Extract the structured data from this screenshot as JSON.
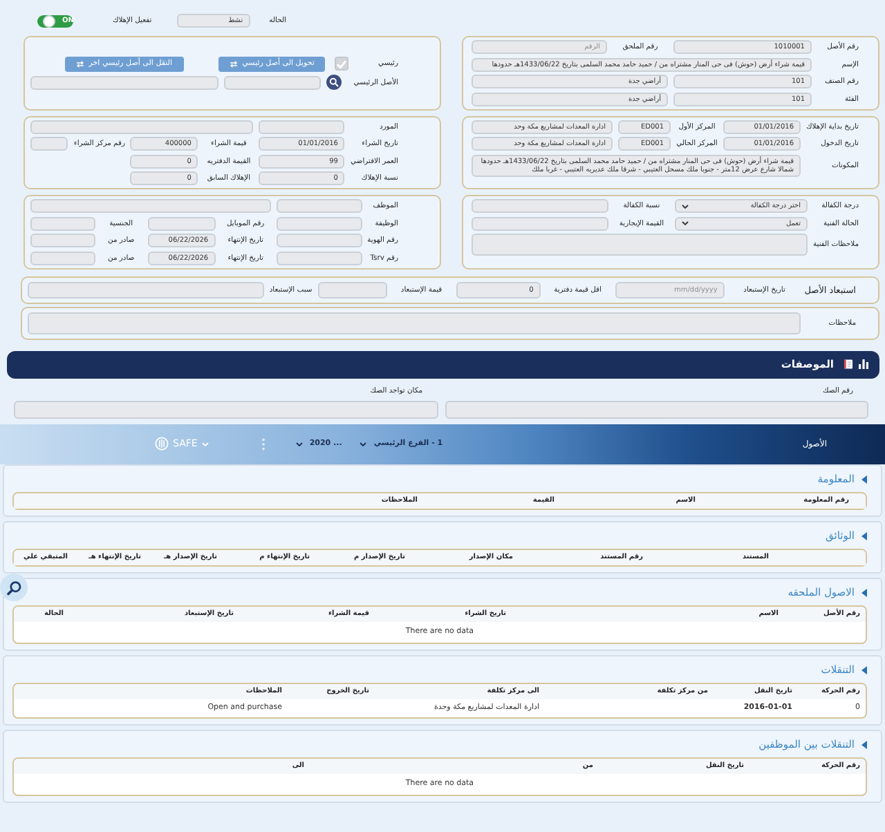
{
  "header": {
    "status": {
      "label": "الحاله",
      "value": "نشط"
    },
    "depreciation": {
      "label": "تفعيل الإهلاك",
      "text": "ON",
      "on": true
    }
  },
  "boxes": [
    {
      "rows": [
        [
          {
            "kind": "label",
            "text": "رقم الأصل"
          },
          {
            "kind": "field",
            "value": "1010001"
          },
          {
            "kind": "label",
            "text": "رقم الملحق"
          },
          {
            "kind": "field",
            "placeholder": "الرقم"
          }
        ],
        [
          {
            "kind": "label",
            "text": "الإسم"
          },
          {
            "kind": "wide",
            "value": "قيمة شراء أرض (حوش) فى حى المنار مشتراه من / حميد حامد محمد السلمى بتاريخ 1433/06/22هـ حدودها"
          }
        ],
        [
          {
            "kind": "label",
            "text": "رقم الصنف"
          },
          {
            "kind": "field",
            "value": "101"
          },
          {
            "kind": "wide",
            "value": "أراضي جدة"
          }
        ],
        [
          {
            "kind": "label",
            "text": "الفئة"
          },
          {
            "kind": "field",
            "value": "101"
          },
          {
            "kind": "wide",
            "value": "أراضي جدة"
          }
        ]
      ]
    },
    {
      "rows": [
        [
          {
            "kind": "label",
            "text": "رئيسي"
          },
          {
            "kind": "check",
            "checked": true,
            "disabled": true
          },
          {
            "kind": "button",
            "text": "تحويل الى أصل رئيسي"
          },
          {
            "kind": "button",
            "text": "النقل الى أصل رئيسي اخر"
          }
        ],
        [
          {
            "kind": "label",
            "text": "الأصل الرئيسي"
          },
          {
            "kind": "search"
          },
          {
            "kind": "field"
          },
          {
            "kind": "wide"
          }
        ]
      ]
    },
    {
      "rows": [
        [
          {
            "kind": "label",
            "text": "تاريخ بداية الإهلاك"
          },
          {
            "kind": "field",
            "value": "01/01/2016"
          },
          {
            "kind": "label",
            "text": "المركز الأول"
          },
          {
            "kind": "field",
            "value": "ED001"
          },
          {
            "kind": "field",
            "value": "ادارة المعدات لمشاريع مكة وحد"
          }
        ],
        [
          {
            "kind": "label",
            "text": "تاريخ الدخول"
          },
          {
            "kind": "field",
            "value": "01/01/2016"
          },
          {
            "kind": "label",
            "text": "المركز الحالي"
          },
          {
            "kind": "field",
            "value": "ED001"
          },
          {
            "kind": "field",
            "value": "ادارة المعدات لمشاريع مكة وحد"
          }
        ],
        [
          {
            "kind": "label",
            "text": "المكونات"
          },
          {
            "kind": "area",
            "value": "قيمة شراء أرض (حوش) فى حى المنار مشتراه من / حميد حامد محمد السلمى بتاريخ 1433/06/22هـ حدودها شمالا شارع عرض 12متر - جنوبا ملك مسحل العتيبي - شرقا ملك عديريه العتيبي - غربا ملك"
          }
        ]
      ]
    },
    {
      "rows": [
        [
          {
            "kind": "label",
            "text": "المورد"
          },
          {
            "kind": "field"
          },
          {
            "kind": "wide"
          }
        ],
        [
          {
            "kind": "label",
            "text": "تاريخ الشراء"
          },
          {
            "kind": "field",
            "value": "01/01/2016"
          },
          {
            "kind": "label",
            "text": "قيمة الشراء"
          },
          {
            "kind": "field",
            "value": "400000"
          },
          {
            "kind": "label",
            "text": "رقم مركز الشراء"
          },
          {
            "kind": "field"
          }
        ],
        [
          {
            "kind": "label",
            "text": "العمر الافتراضي"
          },
          {
            "kind": "field",
            "value": "99"
          },
          {
            "kind": "label",
            "text": "القيمة الدفتريه"
          },
          {
            "kind": "field",
            "value": "0"
          }
        ],
        [
          {
            "kind": "label",
            "text": "نسبة الإهلاك"
          },
          {
            "kind": "field",
            "value": "0"
          },
          {
            "kind": "label",
            "text": "الإهلاك السابق"
          },
          {
            "kind": "field",
            "value": "0"
          }
        ]
      ]
    },
    {
      "rows": [
        [
          {
            "kind": "label",
            "text": "درجة الكفالة"
          },
          {
            "kind": "select",
            "value": "اختر درجة الكفالة"
          },
          {
            "kind": "label",
            "text": "نسبة الكفالة"
          },
          {
            "kind": "field"
          }
        ],
        [
          {
            "kind": "label",
            "text": "الحالة الفنية"
          },
          {
            "kind": "select",
            "value": "تعمل"
          },
          {
            "kind": "label",
            "text": "القيمة الإيجارية"
          },
          {
            "kind": "field"
          }
        ],
        [
          {
            "kind": "label",
            "text": "ملاحظات الفنية"
          },
          {
            "kind": "area"
          }
        ]
      ]
    },
    {
      "rows": [
        [
          {
            "kind": "label",
            "text": "الموظف"
          },
          {
            "kind": "field"
          },
          {
            "kind": "wide"
          }
        ],
        [
          {
            "kind": "label",
            "text": "الوظيفة"
          },
          {
            "kind": "field"
          },
          {
            "kind": "label",
            "text": "رقم الموبايل"
          },
          {
            "kind": "field"
          },
          {
            "kind": "label",
            "text": "الجنسية"
          },
          {
            "kind": "field"
          }
        ],
        [
          {
            "kind": "label",
            "text": "رقم الهوية"
          },
          {
            "kind": "field"
          },
          {
            "kind": "label",
            "text": "تاريخ الإنتهاء"
          },
          {
            "kind": "field",
            "value": "06/22/2026"
          },
          {
            "kind": "label",
            "text": "صادر من"
          },
          {
            "kind": "field"
          }
        ],
        [
          {
            "kind": "label",
            "text": "رقم Tsrv"
          },
          {
            "kind": "field"
          },
          {
            "kind": "label",
            "text": "تاريخ الإنتهاء"
          },
          {
            "kind": "field",
            "value": "06/22/2026"
          },
          {
            "kind": "label",
            "text": "صادر من"
          },
          {
            "kind": "field"
          }
        ]
      ]
    }
  ],
  "disposal": {
    "rows": [
      [
        {
          "kind": "heading",
          "text": "استبعاد الأصل"
        },
        {
          "kind": "label",
          "text": "تاريخ الإستبعاد"
        },
        {
          "kind": "field",
          "placeholder": "mm/dd/yyyy"
        },
        {
          "kind": "label",
          "text": "اقل قيمة دفترية"
        },
        {
          "kind": "field",
          "value": "0"
        },
        {
          "kind": "label",
          "text": "قيمة الإستبعاد"
        },
        {
          "kind": "field"
        },
        {
          "kind": "label",
          "text": "سبب الإستبعاد"
        },
        {
          "kind": "field"
        }
      ]
    ]
  },
  "notes": {
    "rows": [
      [
        {
          "kind": "label",
          "text": "ملاحظات"
        },
        {
          "kind": "area"
        }
      ]
    ]
  },
  "specs": {
    "title": "الموصفات",
    "fields": [
      {
        "label": "رقم الصك"
      },
      {
        "label": "مكان تواجد الصك"
      }
    ]
  },
  "app_bar": {
    "title": "الأصول",
    "branch": "1 - الفرع الرئيسي",
    "year": "2020 ...",
    "logo": "SAFE"
  },
  "sections": [
    {
      "title": "المعلومة",
      "columns": [
        "رقم المعلومة",
        "الاسم",
        "القيمة",
        "الملاحظات"
      ]
    },
    {
      "title": "الوثائق",
      "columns": [
        "المستند",
        "رقم المستند",
        "مكان الإصدار",
        "تاريخ الإصدار م",
        "تاريخ الإنتهاء م",
        "تاريخ الإصدار هـ",
        "تاريخ الإنتهاء هـ",
        "المتبقي علي"
      ]
    },
    {
      "title": "الاصول الملحقه",
      "columns": [
        "رقم الأصل",
        "الاسم",
        "تاريخ الشراء",
        "قيمة الشراء",
        "تاريخ الإستبعاد",
        "الحالة"
      ],
      "empty_text": "There are no data"
    },
    {
      "title": "التنقلات",
      "columns": [
        "رقم الحركة",
        "تاريخ النقل",
        "من مركز تكلفة",
        "الى مركز تكلفة",
        "تاريخ الخروج",
        "الملاحظات"
      ],
      "rows": [
        [
          "0",
          "2016-01-01",
          null,
          "ادارة المعدات لمشاريع مكة وحدة",
          null,
          "Open and purchase"
        ]
      ]
    },
    {
      "title": "التنقلات بين الموظفين",
      "columns": [
        "رقم الحركة",
        "تاريخ النقل",
        "من",
        "الى"
      ],
      "empty_text": "There are no data"
    }
  ]
}
